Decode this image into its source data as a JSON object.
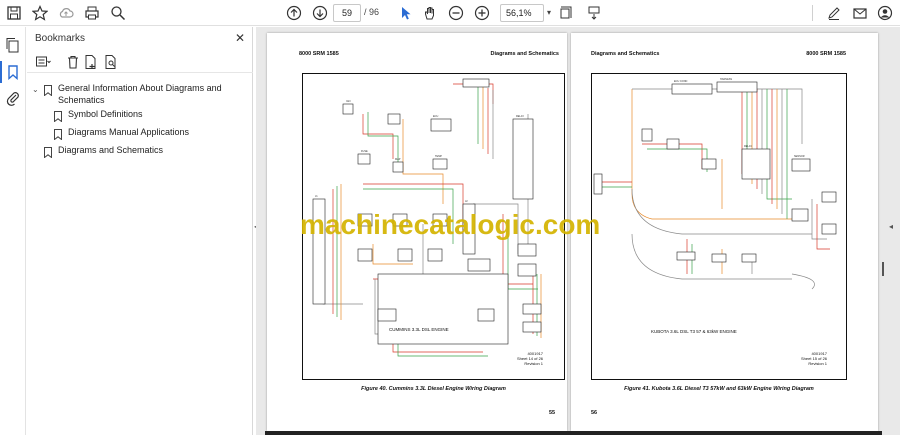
{
  "toolbar": {
    "page_current": "59",
    "page_total": "/ 96",
    "zoom": "56,1%"
  },
  "panel": {
    "title": "Bookmarks",
    "close": "✕"
  },
  "bookmarks": [
    {
      "label": "General Information About Diagrams and"
    },
    {
      "label": "Schematics"
    },
    {
      "label": "Symbol Definitions"
    },
    {
      "label": "Diagrams Manual Applications"
    },
    {
      "label": "Diagrams and Schematics"
    }
  ],
  "page_left": {
    "header_left": "8000 SRM 1585",
    "header_right": "Diagrams and Schematics",
    "caption": "Figure 40. Cummins 3.3L Diesel Engine Wiring Diagram",
    "engine_label": "CUMMINS 3.3L DSL ENGINE",
    "info": [
      "4001917",
      "Sheet 14 of 26",
      "Revision 1"
    ],
    "page_number": "55"
  },
  "page_right": {
    "header_left": "Diagrams and Schematics",
    "header_right": "8000 SRM 1585",
    "caption": "Figure 41. Kubota 3.6L Diesel T3 57kW and 63kW Engine Wiring Diagram",
    "engine_label": "KUBOTA 3.6L DSL T3 57 & 63kW ENGINE",
    "info": [
      "4001917",
      "Sheet 15 of 26",
      "Revision 1"
    ],
    "page_number": "56"
  },
  "watermark": "machinecatalogic.com",
  "colors": {
    "accent": "#2b6cd3",
    "watermark": "#d4b400",
    "wire_red": "#d83a2b",
    "wire_green": "#3aa24a",
    "wire_orange": "#e88a2a"
  }
}
